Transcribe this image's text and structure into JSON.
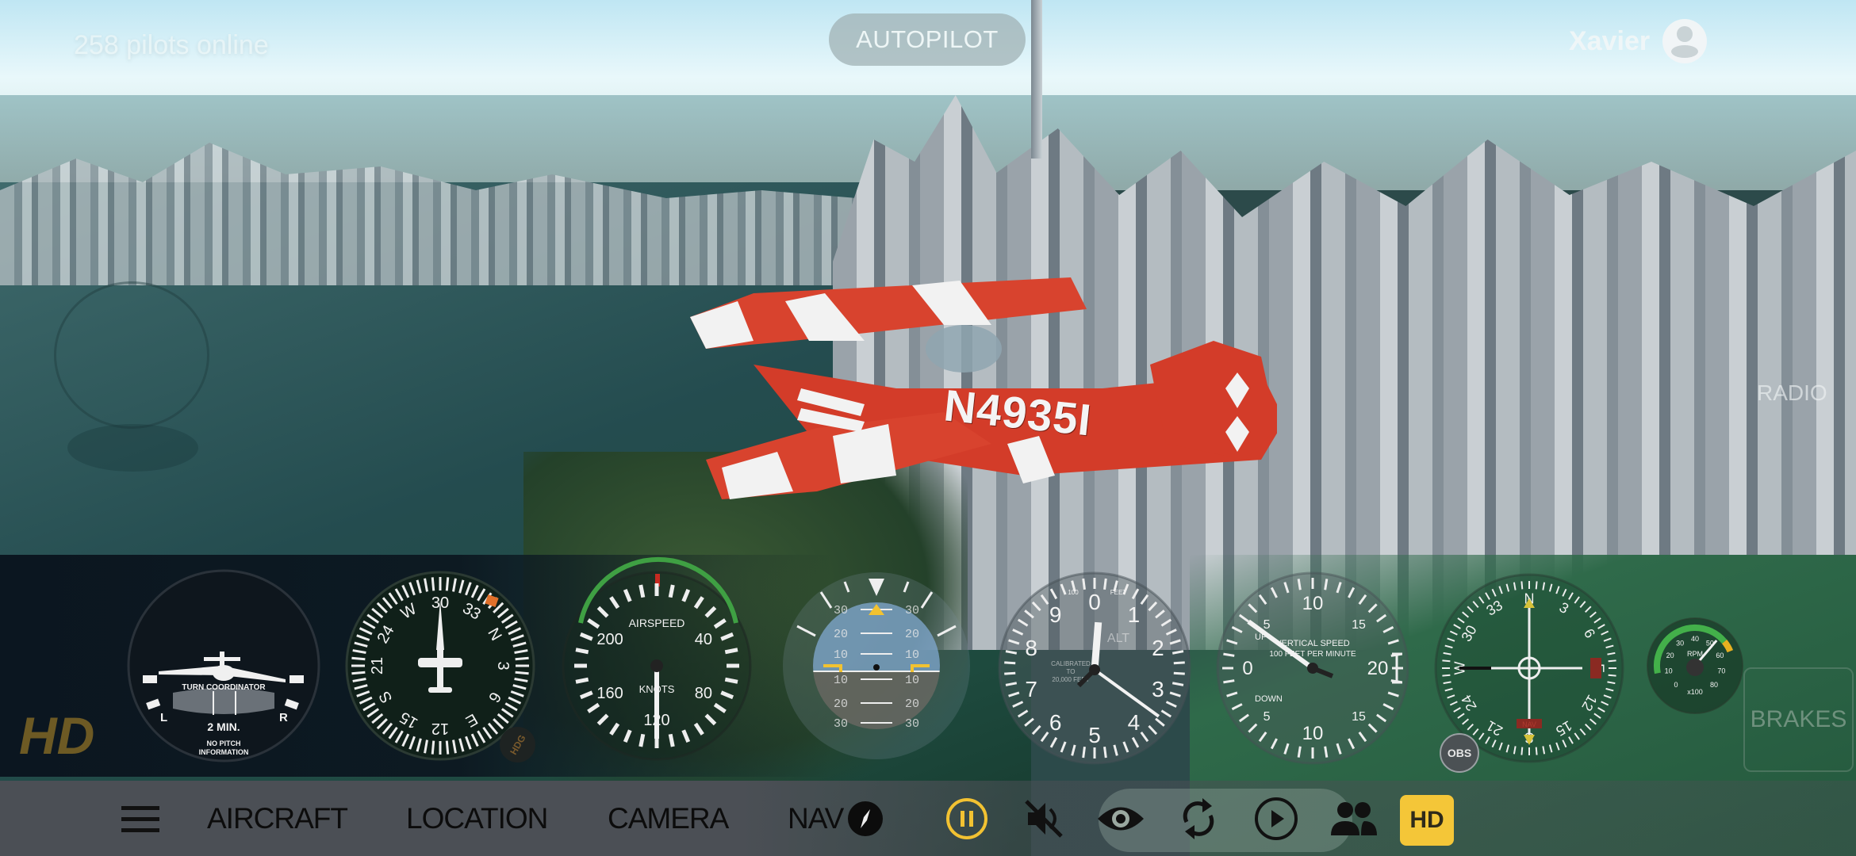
{
  "top": {
    "pilots_online": "258 pilots online",
    "autopilot_label": "AUTOPILOT",
    "user_name": "Xavier"
  },
  "scene": {
    "aircraft_registration": "N4935I",
    "radio_label": "RADIO",
    "brakes_label": "BRAKES",
    "hd_badge": "HD"
  },
  "instruments": {
    "turn_coordinator": {
      "title": "TURN COORDINATOR",
      "left": "L",
      "right": "R",
      "rate": "2 MIN.",
      "note_line1": "NO PITCH",
      "note_line2": "INFORMATION"
    },
    "heading_indicator": {
      "labels": [
        "N",
        "3",
        "6",
        "E",
        "12",
        "15",
        "S",
        "21",
        "24",
        "W",
        "30",
        "33"
      ],
      "heading_deg": 300,
      "hdg_button": "HDG"
    },
    "airspeed": {
      "title": "AIRSPEED",
      "units": "KNOTS",
      "labels": [
        "40",
        "80",
        "120",
        "160",
        "200"
      ],
      "value_knots": 120
    },
    "attitude": {
      "pitch_labels": [
        "30",
        "20",
        "10",
        "10",
        "20",
        "30"
      ],
      "pitch_deg": 0,
      "bank_deg": 0
    },
    "altimeter": {
      "labels": [
        "0",
        "1",
        "2",
        "3",
        "4",
        "5",
        "6",
        "7",
        "8",
        "9"
      ],
      "units_small": "100",
      "units_feet": "FEET",
      "alt_label": "ALT",
      "calib_line1": "CALIBRATED",
      "calib_line2": "TO",
      "calib_line3": "20,000 FEET",
      "value_ft": 1350
    },
    "vertical_speed": {
      "title": "VERTICAL SPEED",
      "subtitle": "100 FEET PER MINUTE",
      "up": "UP",
      "down": "DOWN",
      "labels": [
        "0",
        "5",
        "10",
        "15",
        "20",
        "15",
        "10",
        "5"
      ],
      "value_fpm": 400
    },
    "nav": {
      "labels": [
        "N",
        "3",
        "6",
        "E",
        "12",
        "15",
        "S",
        "21",
        "24",
        "W",
        "30",
        "33"
      ],
      "obs_button": "OBS",
      "flag": "NAV"
    },
    "rpm": {
      "title": "RPM",
      "multiplier": "x100",
      "labels": [
        "0",
        "10",
        "20",
        "30",
        "40",
        "50",
        "60",
        "70",
        "80"
      ],
      "value_x100": 52
    }
  },
  "bottom_bar": {
    "menu_icon": "hamburger-menu-icon",
    "items": [
      {
        "label": "AIRCRAFT"
      },
      {
        "label": "LOCATION"
      },
      {
        "label": "CAMERA"
      },
      {
        "label": "NAV"
      }
    ],
    "icons": [
      "compass-icon",
      "pause-icon",
      "sound-muted-icon",
      "eye-icon",
      "refresh-icon",
      "play-icon",
      "people-icon"
    ],
    "hd_button": "HD",
    "colors": {
      "accent": "#f4c638",
      "bar": "#4b4f55"
    }
  }
}
